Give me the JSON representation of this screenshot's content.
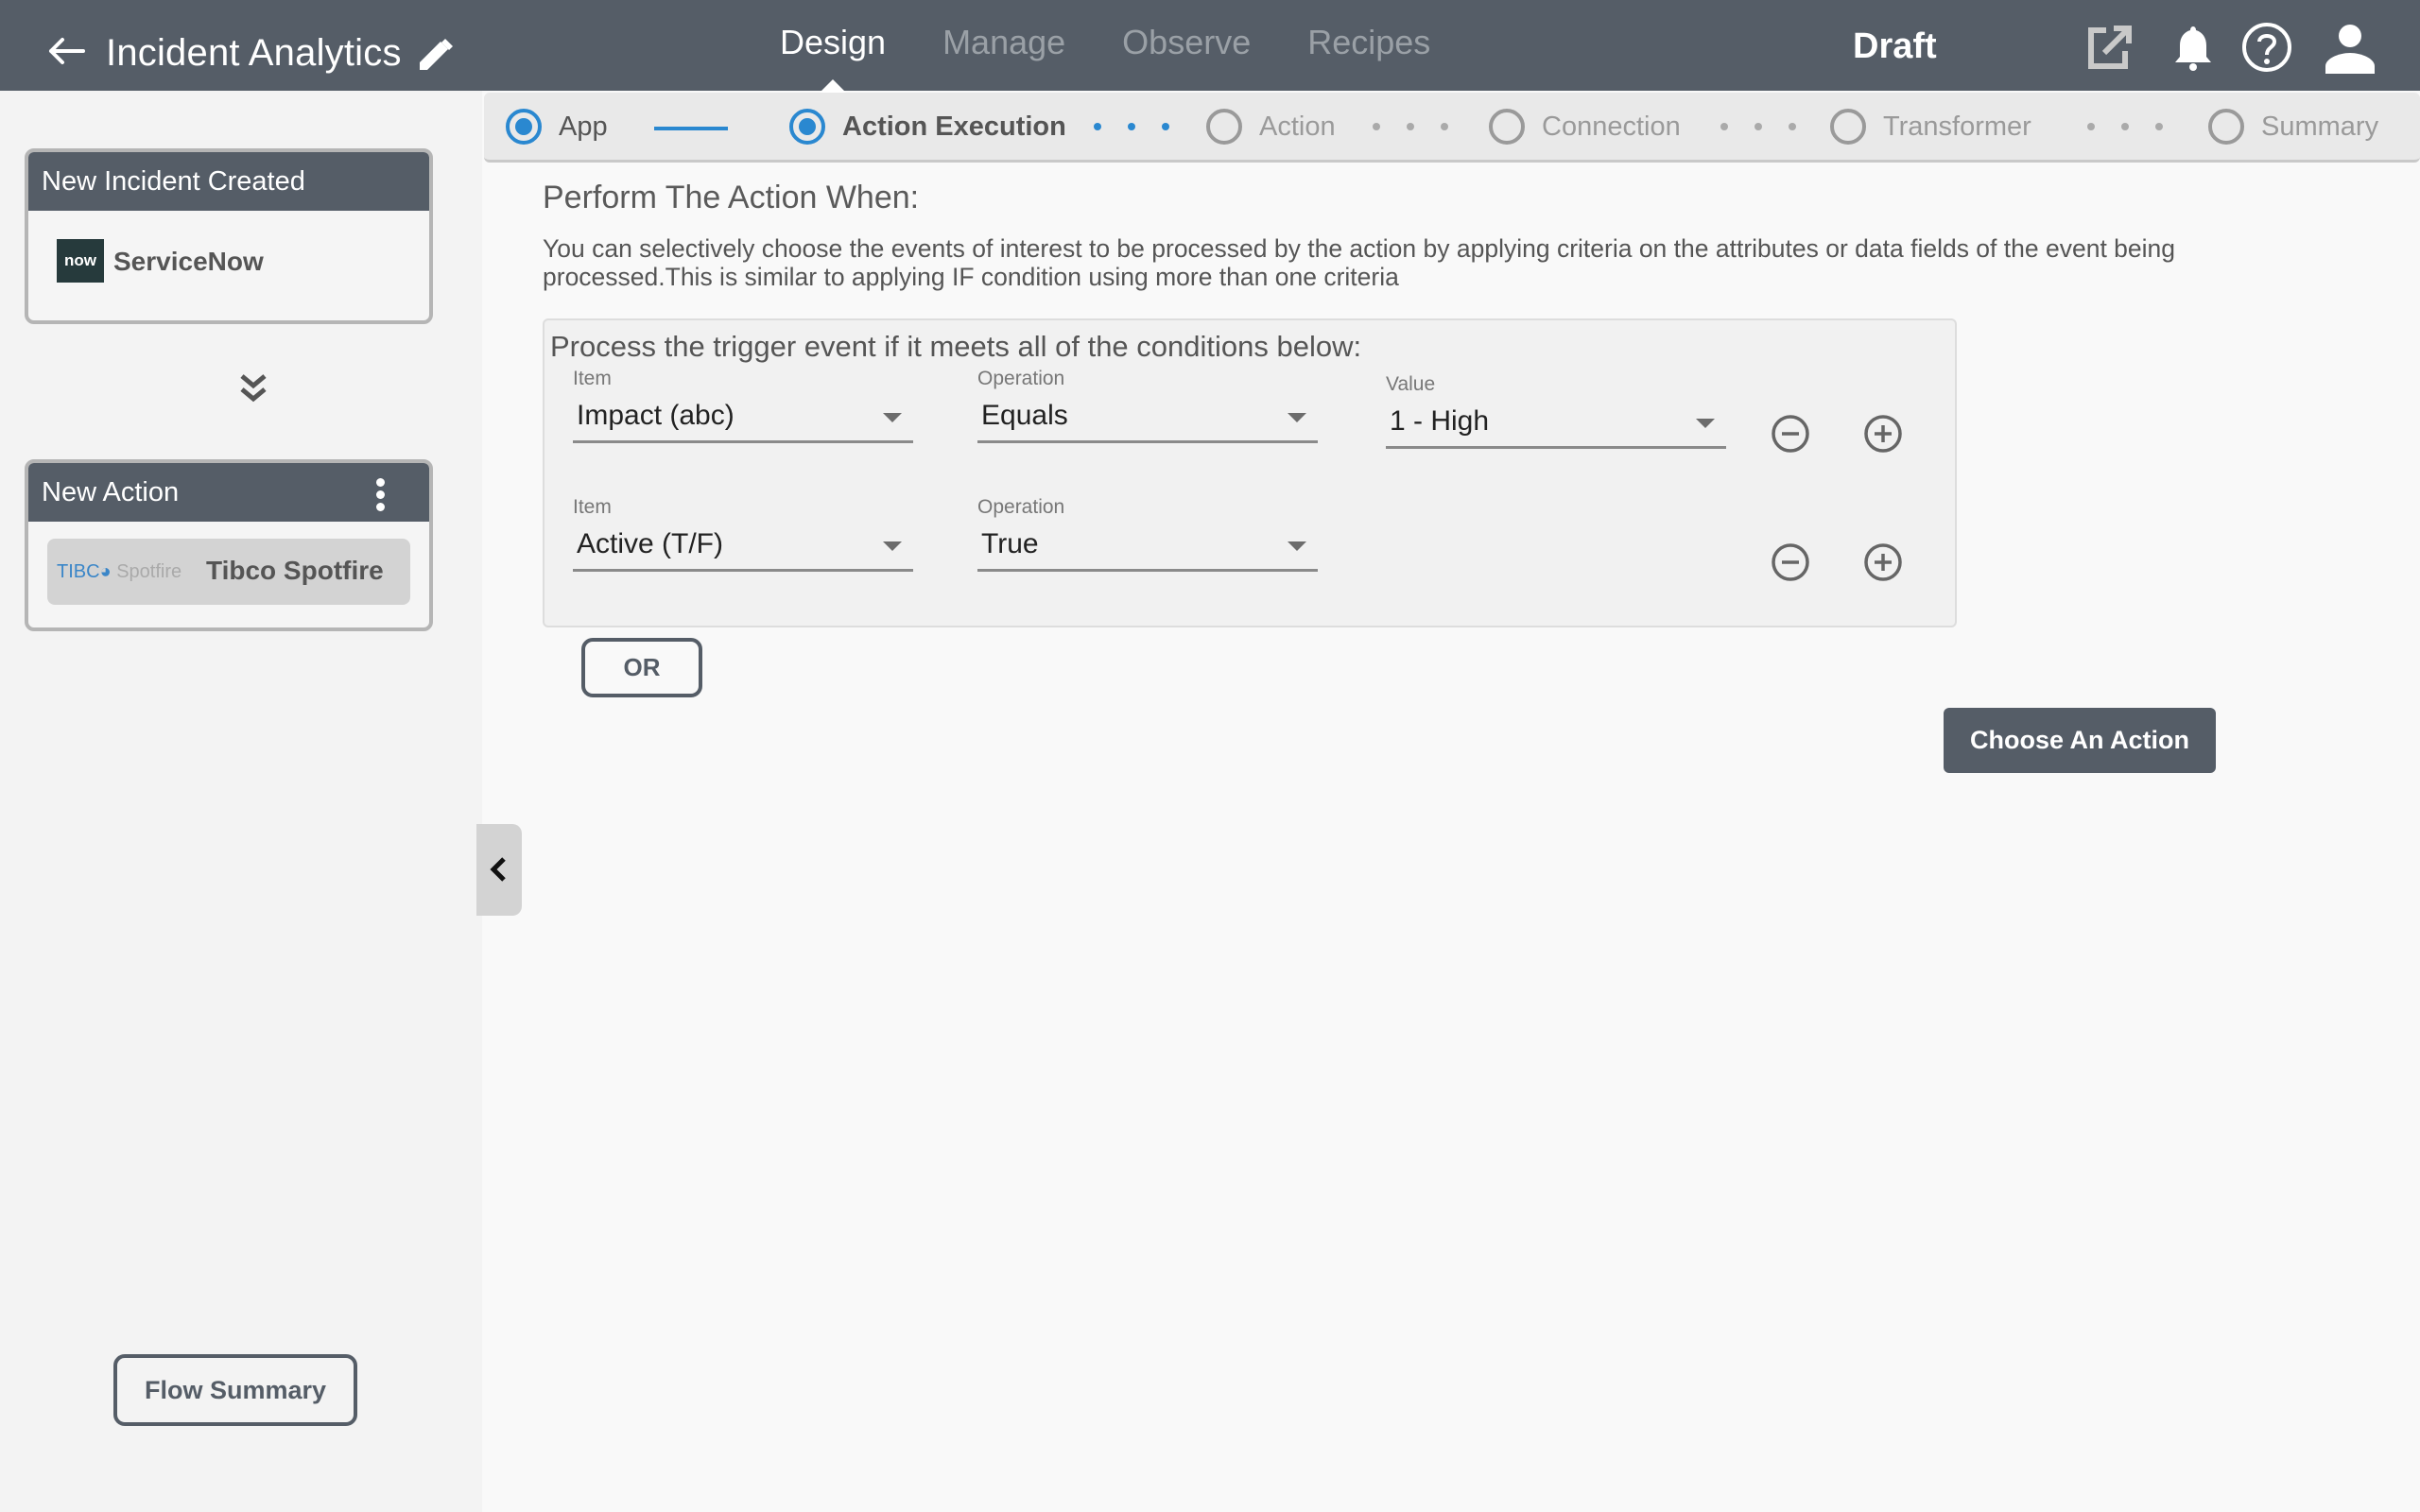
{
  "header": {
    "title": "Incident Analytics",
    "back_icon": "arrow-left-icon",
    "edit_icon": "pencil-icon",
    "tabs": [
      {
        "label": "Design",
        "active": true
      },
      {
        "label": "Manage",
        "active": false
      },
      {
        "label": "Observe",
        "active": false
      },
      {
        "label": "Recipes",
        "active": false
      }
    ],
    "status": "Draft",
    "icons": [
      "open-external-icon",
      "bell-icon",
      "help-icon",
      "user-icon"
    ]
  },
  "stepper": {
    "steps": [
      {
        "label": "App",
        "state": "done"
      },
      {
        "label": "Action Execution",
        "state": "current"
      },
      {
        "label": "Action",
        "state": "pending"
      },
      {
        "label": "Connection",
        "state": "pending"
      },
      {
        "label": "Transformer",
        "state": "pending"
      },
      {
        "label": "Summary",
        "state": "pending"
      }
    ],
    "accent_color": "#2a88d0"
  },
  "sidebar": {
    "trigger_card": {
      "title": "New Incident Created",
      "logo_text": "now",
      "service": "ServiceNow"
    },
    "action_card": {
      "title": "New Action",
      "logo_text_1": "TIBC",
      "logo_text_2": "Spotfire",
      "service": "Tibco Spotfire"
    },
    "flow_summary_label": "Flow Summary"
  },
  "main": {
    "title": "Perform The Action When:",
    "description": "You can selectively choose the events of interest to be processed by the action by applying criteria on the attributes or data fields of the event being processed.This is similar to applying IF condition using more than one criteria",
    "conditions_heading": "Process the trigger event if it meets all of the conditions below:",
    "conditions": [
      {
        "item_label": "Item",
        "item_value": "Impact (abc)",
        "operation_label": "Operation",
        "operation_value": "Equals",
        "value_label": "Value",
        "value_value": "1 - High"
      },
      {
        "item_label": "Item",
        "item_value": "Active (T/F)",
        "operation_label": "Operation",
        "operation_value": "True"
      }
    ],
    "or_label": "OR",
    "choose_action_label": "Choose An Action"
  },
  "colors": {
    "header_bg": "#555d67",
    "accent": "#2a88d0"
  }
}
